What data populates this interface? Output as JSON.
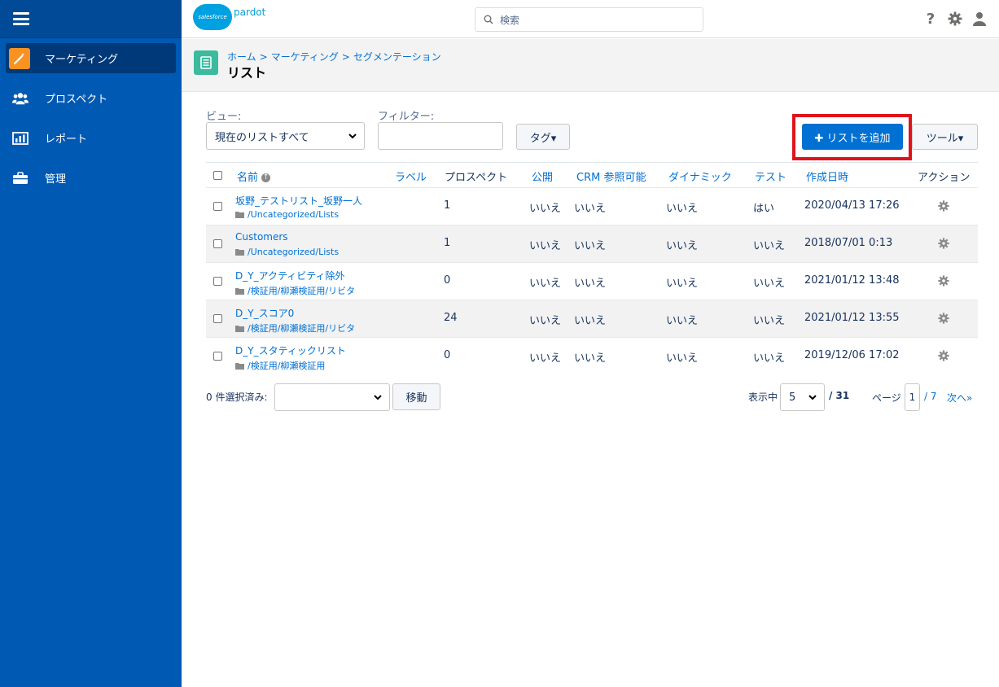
{
  "sidebar": {
    "items": [
      {
        "label": "マーケティング"
      },
      {
        "label": "プロスペクト"
      },
      {
        "label": "レポート"
      },
      {
        "label": "管理"
      }
    ]
  },
  "header": {
    "logo_cloud": "salesforce",
    "logo_product": "pardot",
    "search_placeholder": "検索"
  },
  "page": {
    "breadcrumb": [
      "ホーム",
      "マーケティング",
      "セグメンテーション"
    ],
    "title": "リスト"
  },
  "controls": {
    "view_label": "ビュー:",
    "view_value": "現在のリストすべて",
    "filter_label": "フィルター:",
    "filter_value": "",
    "tag_button": "タグ▾",
    "add_list_button": "✚ リストを追加",
    "tools_button": "ツール▾"
  },
  "table": {
    "columns": {
      "name": "名前",
      "label": "ラベル",
      "prospects": "プロスペクト",
      "public": "公開",
      "crm": "CRM 参照可能",
      "dynamic": "ダイナミック",
      "test": "テスト",
      "created": "作成日時",
      "action": "アクション"
    },
    "rows": [
      {
        "name": "坂野_テストリスト_坂野一人",
        "folder": "/Uncategorized/Lists",
        "prospects": "1",
        "public": "いいえ",
        "crm": "いいえ",
        "dynamic": "いいえ",
        "test": "はい",
        "created": "2020/04/13 17:26"
      },
      {
        "name": "Customers",
        "folder": "/Uncategorized/Lists",
        "prospects": "1",
        "public": "いいえ",
        "crm": "いいえ",
        "dynamic": "いいえ",
        "test": "いいえ",
        "created": "2018/07/01 0:13"
      },
      {
        "name": "D_Y_アクティビティ除外",
        "folder": "/検証用/柳瀬検証用/リビタ",
        "prospects": "0",
        "public": "いいえ",
        "crm": "いいえ",
        "dynamic": "いいえ",
        "test": "いいえ",
        "created": "2021/01/12 13:48"
      },
      {
        "name": "D_Y_スコア0",
        "folder": "/検証用/柳瀬検証用/リビタ",
        "prospects": "24",
        "public": "いいえ",
        "crm": "いいえ",
        "dynamic": "いいえ",
        "test": "いいえ",
        "created": "2021/01/12 13:55"
      },
      {
        "name": "D_Y_スタティックリスト",
        "folder": "/検証用/柳瀬検証用",
        "prospects": "0",
        "public": "いいえ",
        "crm": "いいえ",
        "dynamic": "いいえ",
        "test": "いいえ",
        "created": "2019/12/06 17:02"
      }
    ]
  },
  "footer": {
    "selected_label": "0 件選択済み:",
    "move_button": "移動",
    "display_label": "表示中",
    "page_size": "5",
    "total": "/ 31",
    "page_label": "ページ",
    "page_current": "1",
    "page_total": "/ 7",
    "next": "次へ»"
  }
}
